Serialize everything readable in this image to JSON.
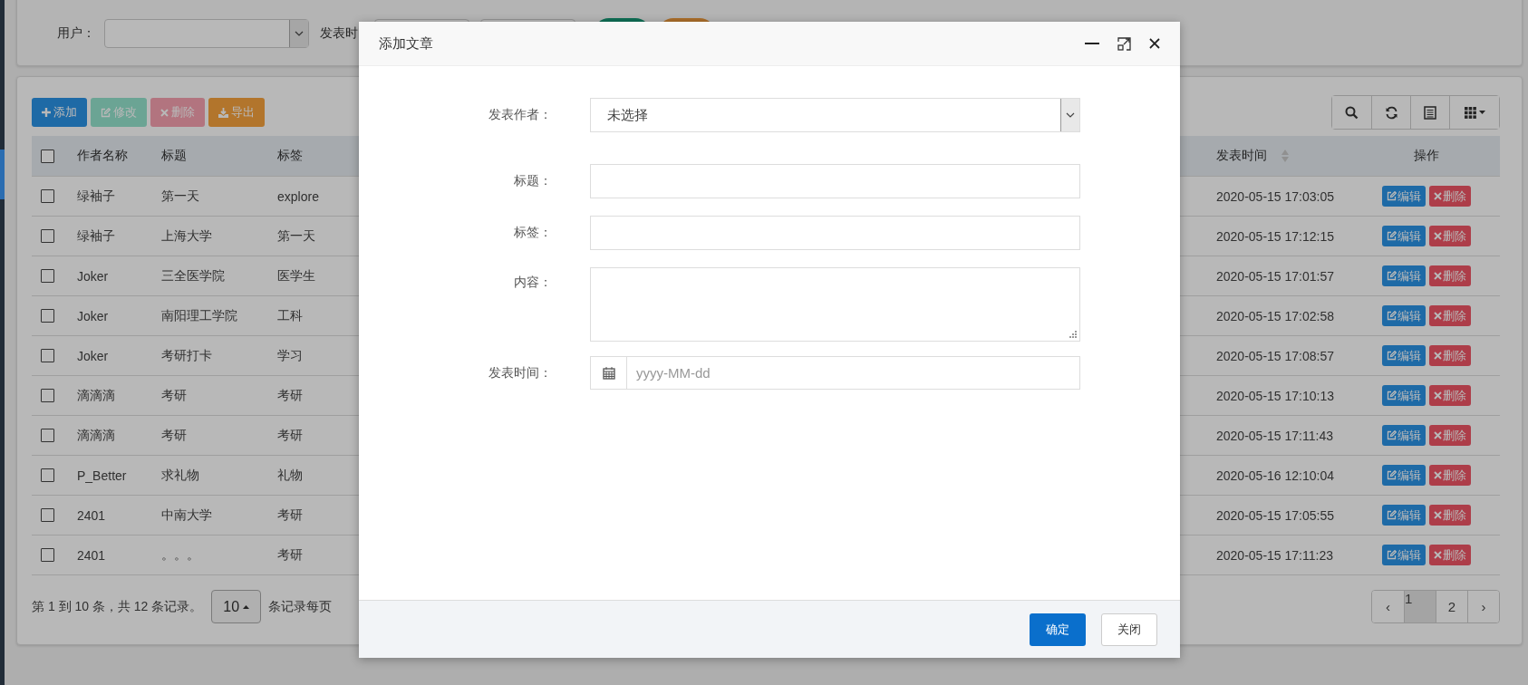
{
  "filter": {
    "user_label": "用户：",
    "date_label": "发表时"
  },
  "toolbar": {
    "buttons": [
      {
        "label": "添加",
        "kind": "add",
        "disabled": false
      },
      {
        "label": "修改",
        "kind": "edit",
        "disabled": true
      },
      {
        "label": "删除",
        "kind": "delete",
        "disabled": true
      },
      {
        "label": "导出",
        "kind": "export",
        "disabled": false
      }
    ]
  },
  "table": {
    "header_checked": false,
    "columns": [
      "作者名称",
      "标题",
      "标签",
      "发表时间",
      "操作"
    ],
    "rows": [
      {
        "checked": false,
        "author": "绿袖子",
        "title": "第一天",
        "tag": "explore",
        "time": "2020-05-15 17:03:05",
        "actions": [
          "编辑",
          "删除"
        ]
      },
      {
        "checked": false,
        "author": "绿袖子",
        "title": "上海大学",
        "tag": "第一天",
        "time": "2020-05-15 17:12:15",
        "actions": [
          "编辑",
          "删除"
        ]
      },
      {
        "checked": false,
        "author": "Joker",
        "title": "三全医学院",
        "tag": "医学生",
        "time": "2020-05-15 17:01:57",
        "actions": [
          "编辑",
          "删除"
        ]
      },
      {
        "checked": false,
        "author": "Joker",
        "title": "南阳理工学院",
        "tag": "工科",
        "time": "2020-05-15 17:02:58",
        "actions": [
          "编辑",
          "删除"
        ]
      },
      {
        "checked": false,
        "author": "Joker",
        "title": "考研打卡",
        "tag": "学习",
        "time": "2020-05-15 17:08:57",
        "actions": [
          "编辑",
          "删除"
        ]
      },
      {
        "checked": false,
        "author": "滴滴滴",
        "title": "考研",
        "tag": "考研",
        "time": "2020-05-15 17:10:13",
        "actions": [
          "编辑",
          "删除"
        ]
      },
      {
        "checked": false,
        "author": "滴滴滴",
        "title": "考研",
        "tag": "考研",
        "time": "2020-05-15 17:11:43",
        "actions": [
          "编辑",
          "删除"
        ]
      },
      {
        "checked": false,
        "author": "P_Better",
        "title": "求礼物",
        "tag": "礼物",
        "time": "2020-05-16 12:10:04",
        "actions": [
          "编辑",
          "删除"
        ]
      },
      {
        "checked": false,
        "author": "2401",
        "title": "中南大学",
        "tag": "考研",
        "time": "2020-05-15 17:05:55",
        "actions": [
          "编辑",
          "删除"
        ]
      },
      {
        "checked": false,
        "author": "2401",
        "title": "。。。",
        "tag": "考研",
        "time": "2020-05-15 17:11:23",
        "actions": [
          "编辑",
          "删除"
        ]
      }
    ]
  },
  "pagination": {
    "summary": "第 1 到 10 条，共 12 条记录。",
    "page_size": "10",
    "page_size_suffix": "条记录每页",
    "pages": [
      {
        "label": "‹",
        "selected": false
      },
      {
        "label": "1",
        "selected": true
      },
      {
        "label": "2",
        "selected": false
      },
      {
        "label": "›",
        "selected": false
      }
    ]
  },
  "modal": {
    "title": "添加文章",
    "fields": [
      {
        "label": "发表作者：",
        "kind": "select",
        "value": "未选择"
      },
      {
        "label": "标题：",
        "kind": "text"
      },
      {
        "label": "标签：",
        "kind": "text"
      },
      {
        "label": "内容：",
        "kind": "textarea"
      },
      {
        "label": "发表时间：",
        "kind": "date",
        "placeholder": "yyyy-MM-dd"
      }
    ],
    "buttons": [
      {
        "label": "确定",
        "kind": "primary"
      },
      {
        "label": "关闭",
        "kind": "default"
      }
    ]
  }
}
